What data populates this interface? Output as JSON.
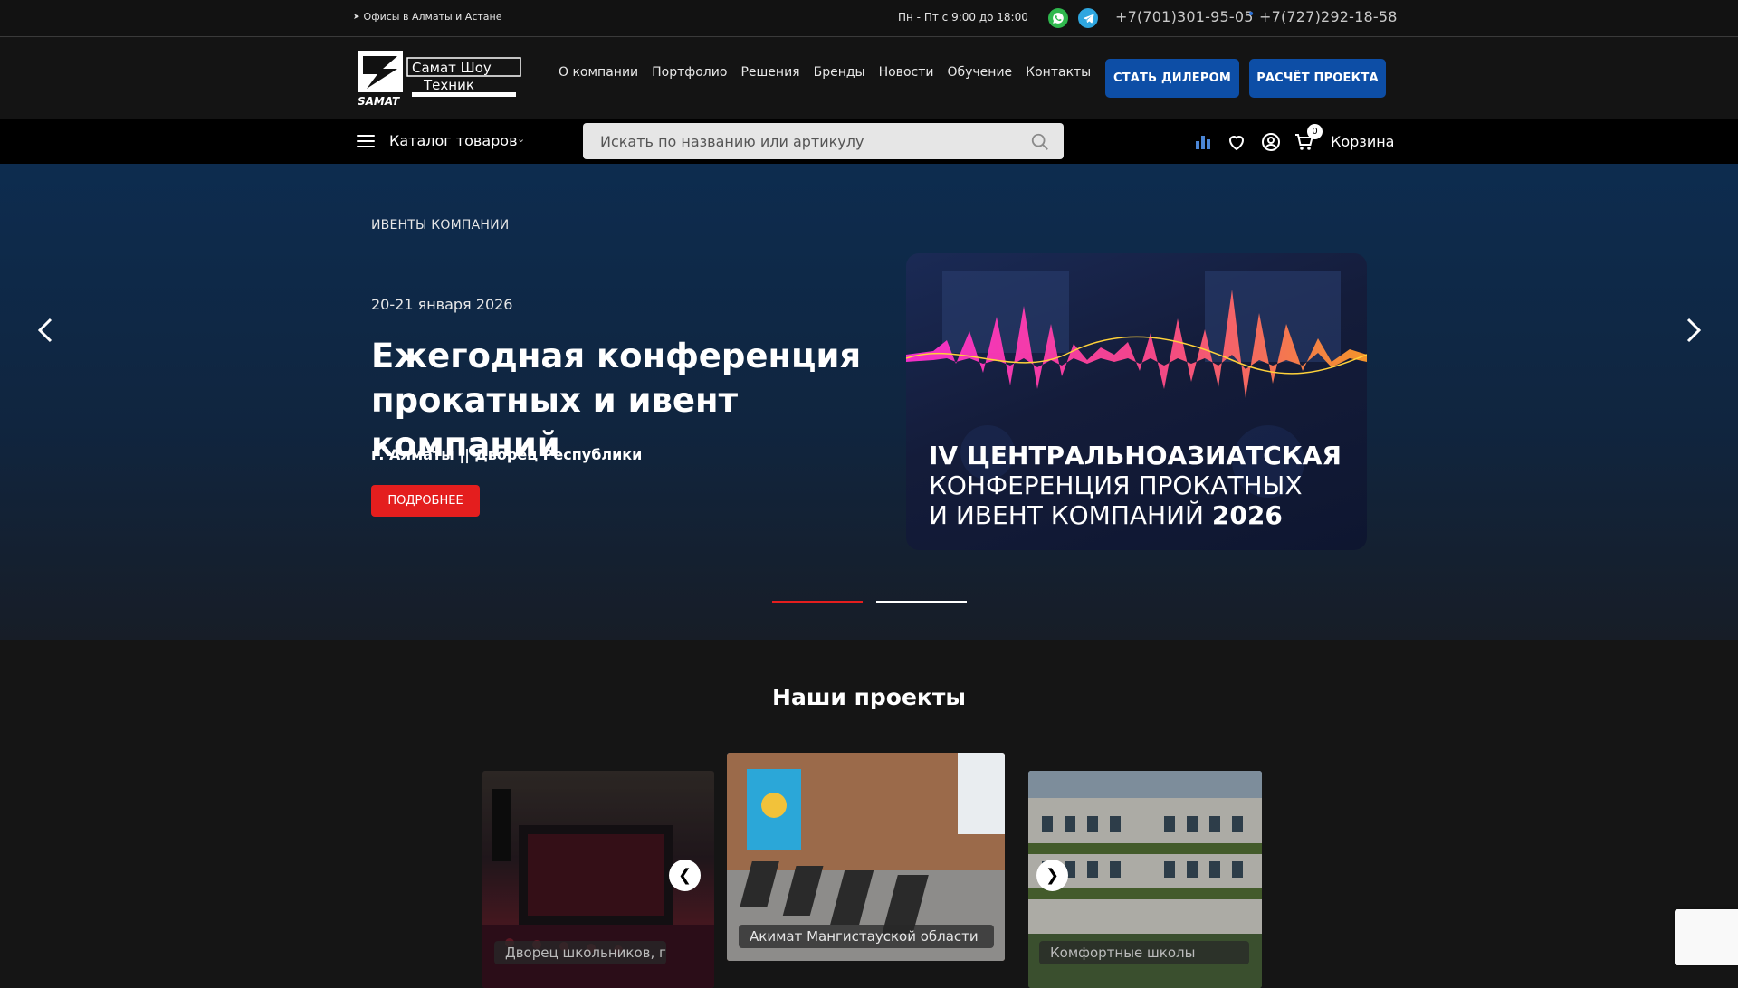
{
  "topbar": {
    "offices": "Офисы в Алматы и Астане",
    "hours": "Пн - Пт с 9:00 до 18:00",
    "phone1": "+7(701)301-95-05",
    "phone2": "+7(727)292-18-58",
    "phone_separator": "•"
  },
  "header": {
    "logo_alt": "Самат Шоу Техник",
    "nav": [
      "О компании",
      "Портфолио",
      "Решения",
      "Бренды",
      "Новости",
      "Обучение",
      "Контакты"
    ],
    "btn_dealer": "СТАТЬ ДИЛЕРОМ",
    "btn_calc": "РАСЧЁТ ПРОЕКТА"
  },
  "catbar": {
    "catalog_label": "Каталог товаров",
    "search_placeholder": "Искать по названию или артикулу",
    "cart_count": "0",
    "cart_label": "Корзина"
  },
  "hero": {
    "category": "ИВЕНТЫ КОМПАНИИ",
    "date": "20-21 января 2026",
    "title": "Ежегодная конференция прокатных и ивент компаний",
    "place": "г. Алматы || Дворец Республики",
    "button": "ПОДРОБНЕЕ",
    "banner_line1": "IV ЦЕНТРАЛЬНОАЗИАТСКАЯ",
    "banner_line2": "КОНФЕРЕНЦИЯ ПРОКАТНЫХ",
    "banner_line3": "И ИВЕНТ КОМПАНИЙ",
    "banner_year": "2026"
  },
  "projects": {
    "title": "Наши проекты",
    "cards": [
      {
        "label": "Дворец школьников, г"
      },
      {
        "label": "Акимат Мангистауской области"
      },
      {
        "label": "Комфортные школы"
      }
    ],
    "prev": "❮",
    "next": "❯"
  },
  "colors": {
    "accent_blue": "#0d4ea6",
    "accent_red": "#e41e1e",
    "whatsapp": "#2fb84d",
    "telegram": "#2ea6df"
  },
  "icons": [
    "location-arrow-icon",
    "whatsapp-icon",
    "telegram-icon",
    "menu-icon",
    "chevron-down-icon",
    "search-icon",
    "compare-icon",
    "heart-icon",
    "user-icon",
    "cart-icon",
    "arrow-left-icon",
    "arrow-right-icon"
  ]
}
